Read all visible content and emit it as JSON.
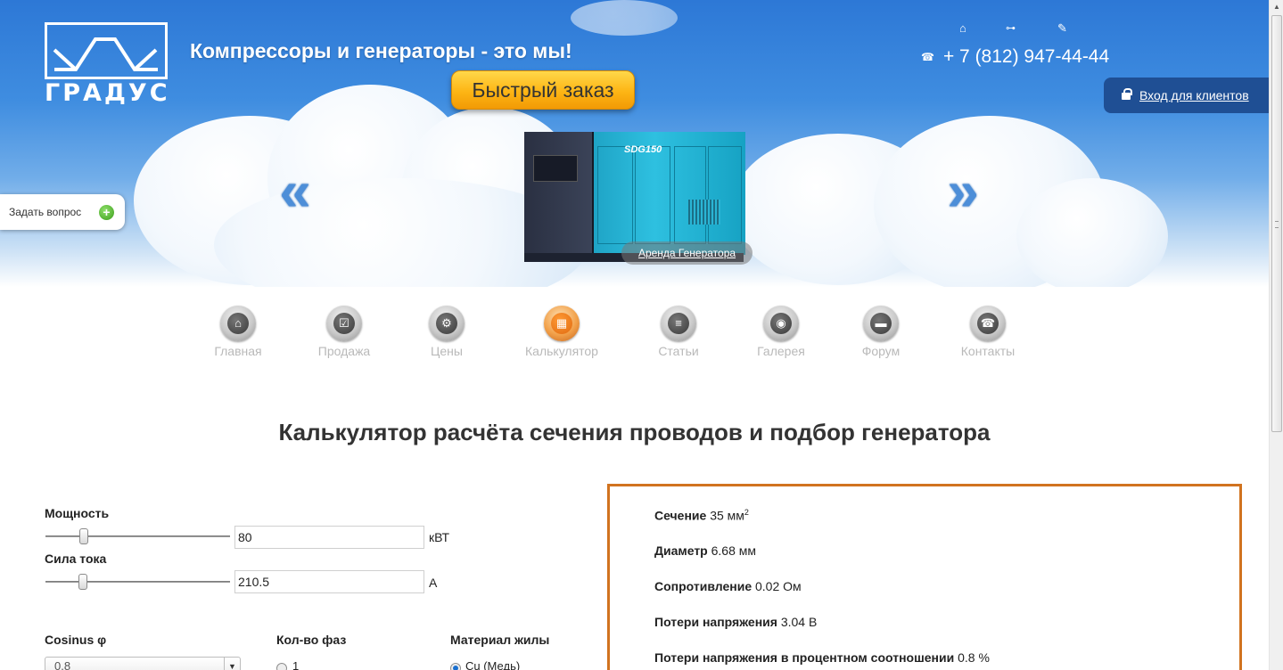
{
  "header": {
    "logo_text": "ГРАДУС",
    "slogan": "Компрессоры и генераторы - это мы!",
    "quick_order": "Быстрый заказ",
    "phone": "+ 7 (812) 947-44-44",
    "login": "Вход для клиентов",
    "top_icons": [
      "home-icon",
      "sitemap-icon",
      "pencil-icon"
    ]
  },
  "slider": {
    "prev": "«",
    "next": "»",
    "generator_model": "SDG150",
    "caption": "Аренда Генератора"
  },
  "ask_question": {
    "label": "Задать вопрос",
    "plus": "+"
  },
  "nav": {
    "items": [
      {
        "label": "Главная",
        "icon": "home-icon"
      },
      {
        "label": "Продажа",
        "icon": "checkbox-icon"
      },
      {
        "label": "Цены",
        "icon": "gears-icon"
      },
      {
        "label": "Калькулятор",
        "icon": "calculator-icon",
        "active": true
      },
      {
        "label": "Статьи",
        "icon": "document-icon"
      },
      {
        "label": "Галерея",
        "icon": "camera-icon"
      },
      {
        "label": "Форум",
        "icon": "chat-icon"
      },
      {
        "label": "Контакты",
        "icon": "phone-icon"
      }
    ]
  },
  "calculator": {
    "title": "Калькулятор расчёта сечения проводов и подбор генератора",
    "power": {
      "label": "Мощность",
      "value": "80",
      "unit": "кВТ"
    },
    "current": {
      "label": "Сила тока",
      "value": "210.5",
      "unit": "А"
    },
    "cosinus": {
      "label": "Cosinus φ",
      "selected": "0.8"
    },
    "phases": {
      "label": "Кол-во фаз",
      "option": "1"
    },
    "material": {
      "label": "Материал жилы",
      "option": "Cu (Медь)"
    }
  },
  "results": {
    "section": {
      "label": "Сечение",
      "value": "35 мм",
      "sup": "2"
    },
    "diameter": {
      "label": "Диаметр",
      "value": "6.68 мм"
    },
    "resistance": {
      "label": "Сопротивление",
      "value": "0.02 Ом"
    },
    "voltage_loss": {
      "label": "Потери напряжения",
      "value": "3.04 В"
    },
    "voltage_loss_pct": {
      "label": "Потери напряжения в процентном соотношении",
      "value": "0.8 %"
    }
  },
  "colors": {
    "accent_orange": "#f29a05",
    "result_border": "#d1731f",
    "login_bg": "#1f4f94"
  }
}
